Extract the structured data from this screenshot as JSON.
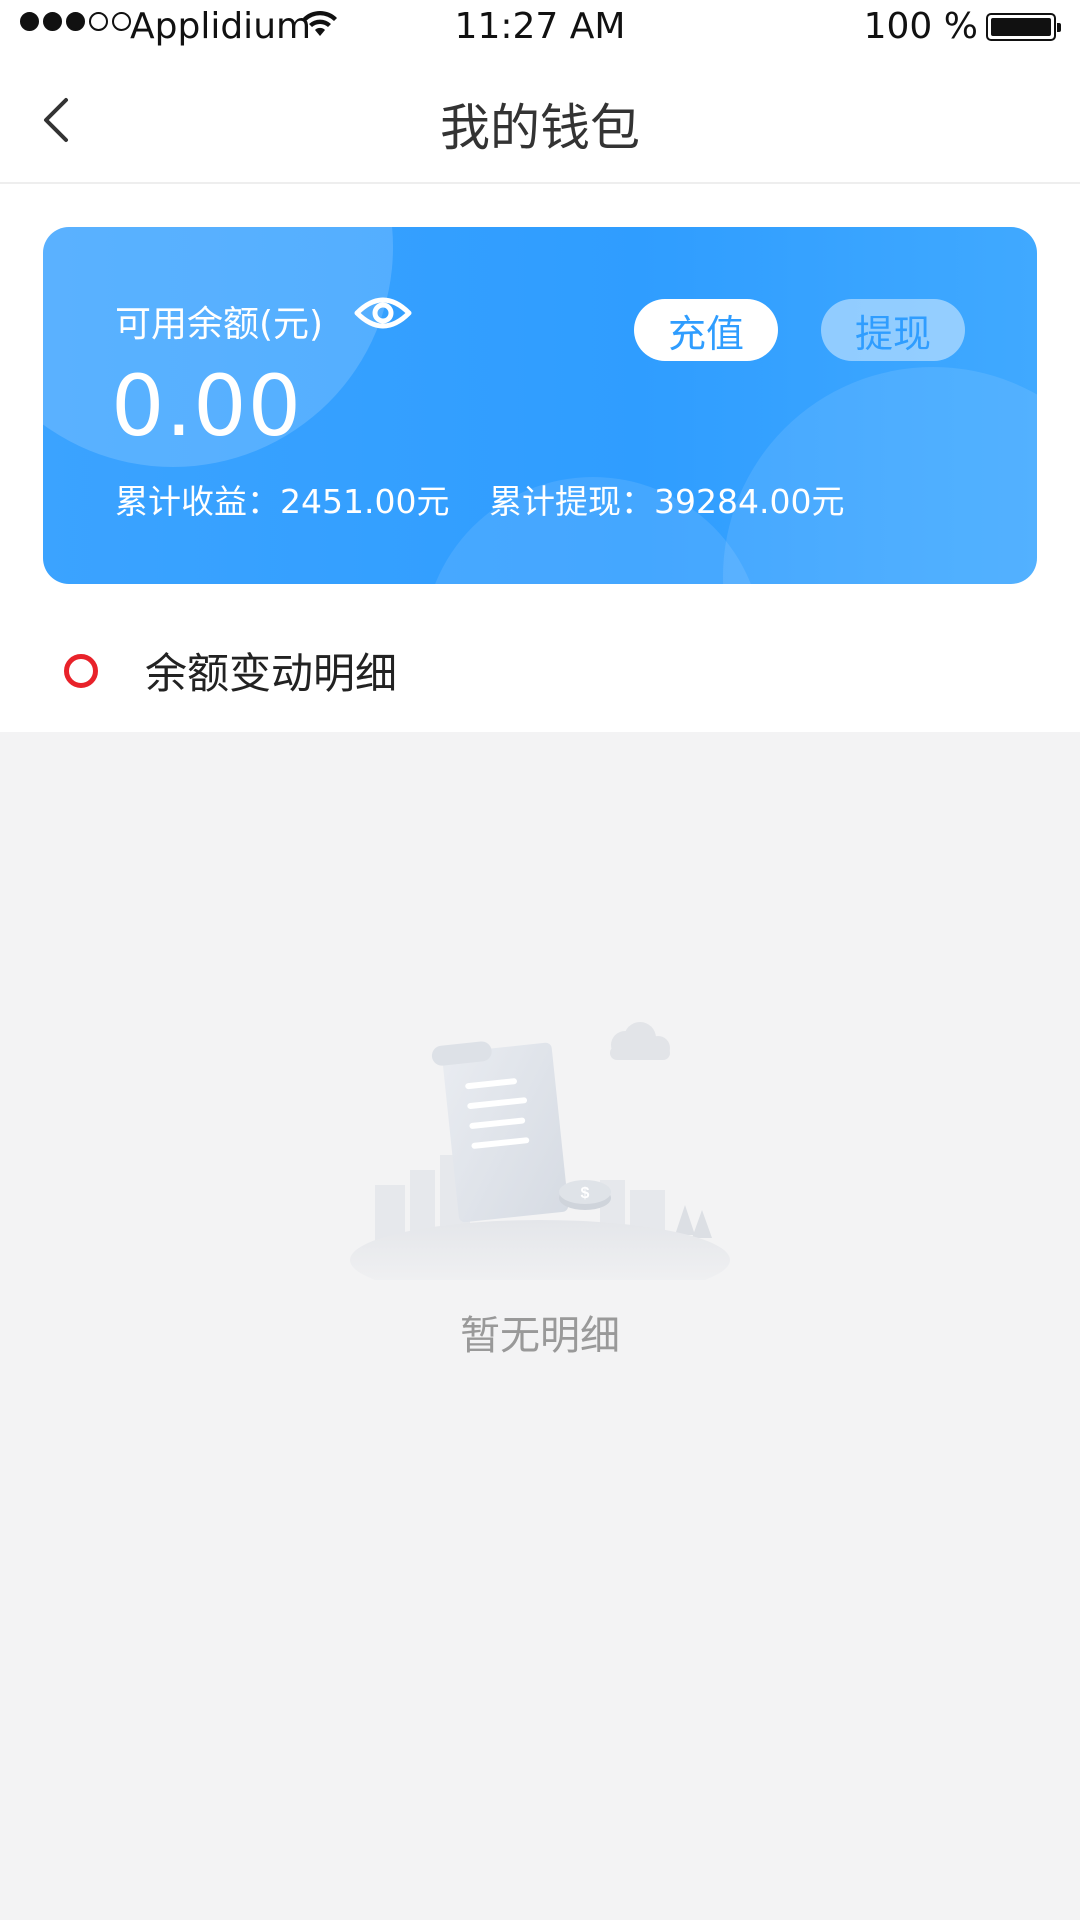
{
  "status_bar": {
    "carrier": "Applidium",
    "time": "11:27 AM",
    "battery": "100 %"
  },
  "nav": {
    "title": "我的钱包",
    "back_icon": "chevron-left-icon"
  },
  "wallet": {
    "balance_label": "可用余额(元)",
    "balance_value": "0.00",
    "recharge_label": "充值",
    "withdraw_label": "提现",
    "total_earnings": "累计收益：2451.00元",
    "total_withdrawn": "累计提现：39284.00元",
    "colors": {
      "card": "#2f9dff",
      "accent": "#2f9dff"
    }
  },
  "section": {
    "title": "余额变动明细",
    "ring_color": "#e8222a"
  },
  "empty": {
    "text": "暂无明细",
    "icon": "receipt-illustration-icon"
  }
}
